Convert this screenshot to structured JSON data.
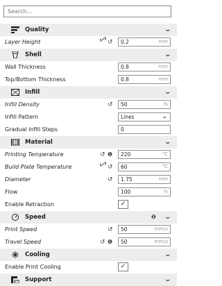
{
  "search": {
    "placeholder": "Search..."
  },
  "sections": {
    "quality": "Quality",
    "shell": "Shell",
    "infill": "Infill",
    "material": "Material",
    "speed": "Speed",
    "cooling": "Cooling",
    "support": "Support"
  },
  "settings": {
    "layer_height": {
      "label": "Layer Height",
      "value": "0.2",
      "unit": "mm"
    },
    "wall_thickness": {
      "label": "Wall Thickness",
      "value": "0.8",
      "unit": "mm"
    },
    "top_bottom_thickness": {
      "label": "Top/Bottom Thickness",
      "value": "0.8",
      "unit": "mm"
    },
    "infill_density": {
      "label": "Infill Density",
      "value": "50",
      "unit": "%"
    },
    "infill_pattern": {
      "label": "Infill Pattern",
      "value": "Lines"
    },
    "gradual_infill_steps": {
      "label": "Gradual Infill Steps",
      "value": "0"
    },
    "printing_temperature": {
      "label": "Printing Temperature",
      "value": "220",
      "unit": "°C"
    },
    "build_plate_temperature": {
      "label": "Build Plate Temperature",
      "value": "60",
      "unit": "°C"
    },
    "diameter": {
      "label": "Diameter",
      "value": "1.75",
      "unit": "mm"
    },
    "flow": {
      "label": "Flow",
      "value": "100",
      "unit": "%"
    },
    "enable_retraction": {
      "label": "Enable Retraction",
      "checked": true,
      "check_glyph": "✓"
    },
    "print_speed": {
      "label": "Print Speed",
      "value": "50",
      "unit": "mm/s"
    },
    "travel_speed": {
      "label": "Travel Speed",
      "value": "50",
      "unit": "mm/s"
    },
    "enable_print_cooling": {
      "label": "Enable Print Cooling",
      "checked": true,
      "check_glyph": "✓"
    }
  },
  "icons": {
    "chevron": "⌄",
    "reset": "↺",
    "link": "🔗",
    "info": "❶"
  }
}
